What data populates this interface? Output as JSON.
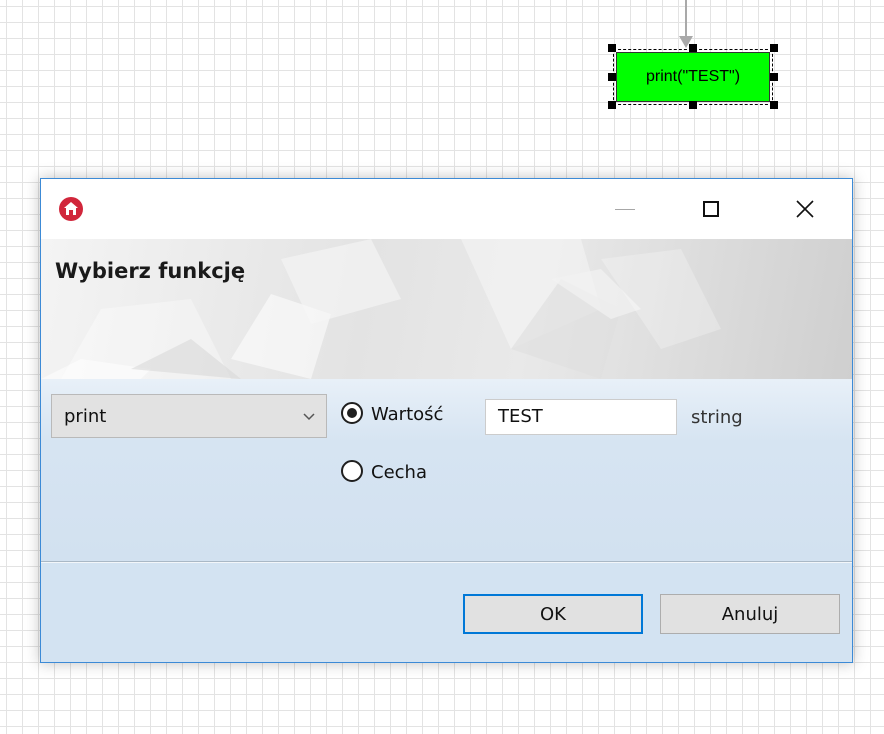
{
  "canvas": {
    "node_label": "print(\"TEST\")",
    "node_color": "#00ff00"
  },
  "dialog": {
    "app_icon": "home-icon",
    "title_buttons": {
      "minimize": "minimize-icon",
      "maximize": "maximize-icon",
      "close": "close-icon"
    },
    "banner_title": "Wybierz funkcję",
    "function_select": {
      "selected": "print"
    },
    "radios": [
      {
        "label": "Wartość",
        "checked": true
      },
      {
        "label": "Cecha",
        "checked": false
      }
    ],
    "value_input": "TEST",
    "value_type": "string",
    "buttons": {
      "ok": "OK",
      "cancel": "Anuluj"
    },
    "accent_color": "#0078d7",
    "border_color": "#3c8ad6",
    "app_icon_color": "#d1263b"
  }
}
